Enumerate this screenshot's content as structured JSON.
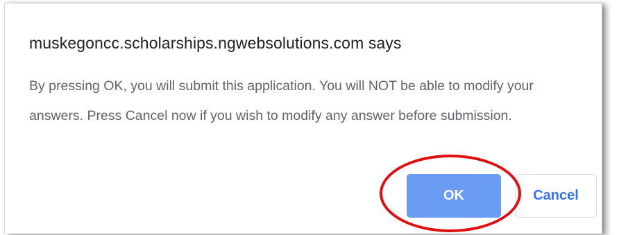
{
  "dialog": {
    "title": "muskegoncc.scholarships.ngwebsolutions.com says",
    "message": "By pressing OK, you will submit this application.  You will NOT be able to modify your answers.  Press Cancel now if you wish to modify any answer before submission.",
    "ok_label": "OK",
    "cancel_label": "Cancel"
  },
  "colors": {
    "ok_background": "#6b9cf3",
    "cancel_text": "#3473e8",
    "highlight_ring": "#e01010"
  }
}
